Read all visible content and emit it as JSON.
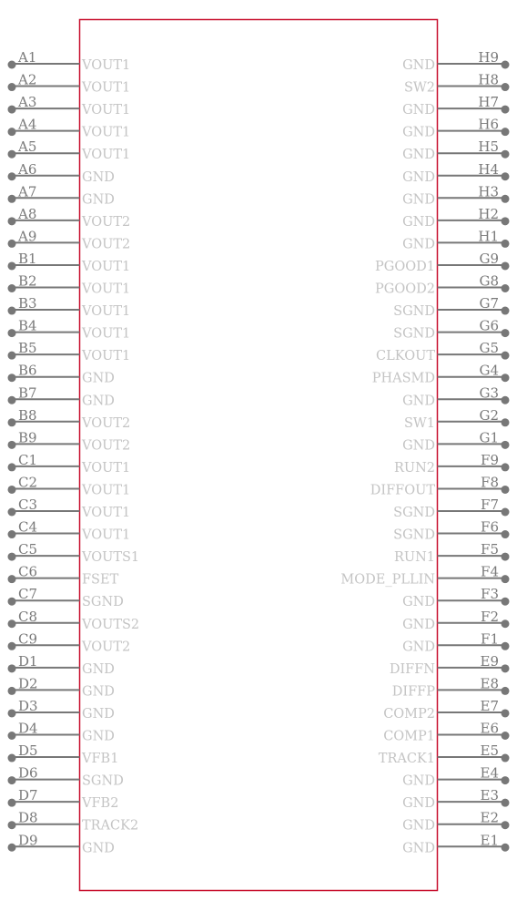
{
  "component": {
    "body_color": "#c8102e",
    "pin_color": "#777777",
    "pin_name_color": "#c4c4c4",
    "pin_number_color": "#7a7a7a"
  },
  "left_pins": [
    {
      "number": "A1",
      "name": "VOUT1"
    },
    {
      "number": "A2",
      "name": "VOUT1"
    },
    {
      "number": "A3",
      "name": "VOUT1"
    },
    {
      "number": "A4",
      "name": "VOUT1"
    },
    {
      "number": "A5",
      "name": "VOUT1"
    },
    {
      "number": "A6",
      "name": "GND"
    },
    {
      "number": "A7",
      "name": "GND"
    },
    {
      "number": "A8",
      "name": "VOUT2"
    },
    {
      "number": "A9",
      "name": "VOUT2"
    },
    {
      "number": "B1",
      "name": "VOUT1"
    },
    {
      "number": "B2",
      "name": "VOUT1"
    },
    {
      "number": "B3",
      "name": "VOUT1"
    },
    {
      "number": "B4",
      "name": "VOUT1"
    },
    {
      "number": "B5",
      "name": "VOUT1"
    },
    {
      "number": "B6",
      "name": "GND"
    },
    {
      "number": "B7",
      "name": "GND"
    },
    {
      "number": "B8",
      "name": "VOUT2"
    },
    {
      "number": "B9",
      "name": "VOUT2"
    },
    {
      "number": "C1",
      "name": "VOUT1"
    },
    {
      "number": "C2",
      "name": "VOUT1"
    },
    {
      "number": "C3",
      "name": "VOUT1"
    },
    {
      "number": "C4",
      "name": "VOUT1"
    },
    {
      "number": "C5",
      "name": "VOUTS1"
    },
    {
      "number": "C6",
      "name": "FSET"
    },
    {
      "number": "C7",
      "name": "SGND"
    },
    {
      "number": "C8",
      "name": "VOUTS2"
    },
    {
      "number": "C9",
      "name": "VOUT2"
    },
    {
      "number": "D1",
      "name": "GND"
    },
    {
      "number": "D2",
      "name": "GND"
    },
    {
      "number": "D3",
      "name": "GND"
    },
    {
      "number": "D4",
      "name": "GND"
    },
    {
      "number": "D5",
      "name": "VFB1"
    },
    {
      "number": "D6",
      "name": "SGND"
    },
    {
      "number": "D7",
      "name": "VFB2"
    },
    {
      "number": "D8",
      "name": "TRACK2"
    },
    {
      "number": "D9",
      "name": "GND"
    }
  ],
  "right_pins": [
    {
      "number": "H9",
      "name": "GND"
    },
    {
      "number": "H8",
      "name": "SW2"
    },
    {
      "number": "H7",
      "name": "GND"
    },
    {
      "number": "H6",
      "name": "GND"
    },
    {
      "number": "H5",
      "name": "GND"
    },
    {
      "number": "H4",
      "name": "GND"
    },
    {
      "number": "H3",
      "name": "GND"
    },
    {
      "number": "H2",
      "name": "GND"
    },
    {
      "number": "H1",
      "name": "GND"
    },
    {
      "number": "G9",
      "name": "PGOOD1"
    },
    {
      "number": "G8",
      "name": "PGOOD2"
    },
    {
      "number": "G7",
      "name": "SGND"
    },
    {
      "number": "G6",
      "name": "SGND"
    },
    {
      "number": "G5",
      "name": "CLKOUT"
    },
    {
      "number": "G4",
      "name": "PHASMD"
    },
    {
      "number": "G3",
      "name": "GND"
    },
    {
      "number": "G2",
      "name": "SW1"
    },
    {
      "number": "G1",
      "name": "GND"
    },
    {
      "number": "F9",
      "name": "RUN2"
    },
    {
      "number": "F8",
      "name": "DIFFOUT"
    },
    {
      "number": "F7",
      "name": "SGND"
    },
    {
      "number": "F6",
      "name": "SGND"
    },
    {
      "number": "F5",
      "name": "RUN1"
    },
    {
      "number": "F4",
      "name": "MODE_PLLIN"
    },
    {
      "number": "F3",
      "name": "GND"
    },
    {
      "number": "F2",
      "name": "GND"
    },
    {
      "number": "F1",
      "name": "GND"
    },
    {
      "number": "E9",
      "name": "DIFFN"
    },
    {
      "number": "E8",
      "name": "DIFFP"
    },
    {
      "number": "E7",
      "name": "COMP2"
    },
    {
      "number": "E6",
      "name": "COMP1"
    },
    {
      "number": "E5",
      "name": "TRACK1"
    },
    {
      "number": "E4",
      "name": "GND"
    },
    {
      "number": "E3",
      "name": "GND"
    },
    {
      "number": "E2",
      "name": "GND"
    },
    {
      "number": "E1",
      "name": "GND"
    }
  ]
}
